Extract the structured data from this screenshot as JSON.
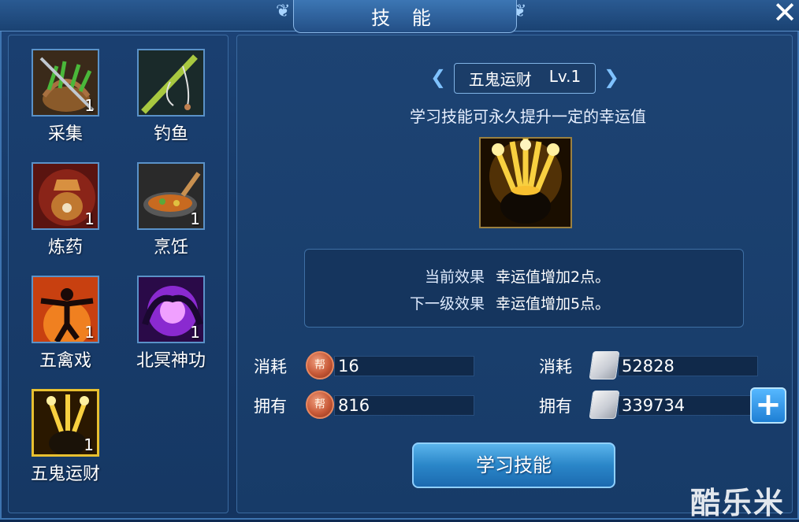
{
  "window": {
    "title": "技 能",
    "close_symbol": "✕"
  },
  "skills": [
    {
      "name": "采集",
      "count": "1",
      "icon": "gathering-icon"
    },
    {
      "name": "钓鱼",
      "count": "",
      "icon": "fishing-icon"
    },
    {
      "name": "炼药",
      "count": "1",
      "icon": "alchemy-icon"
    },
    {
      "name": "烹饪",
      "count": "1",
      "icon": "cooking-icon"
    },
    {
      "name": "五禽戏",
      "count": "1",
      "icon": "five-animals-icon"
    },
    {
      "name": "北冥神功",
      "count": "1",
      "icon": "beiming-icon"
    },
    {
      "name": "五鬼运财",
      "count": "1",
      "icon": "treasure-pot-icon",
      "selected": true
    }
  ],
  "detail": {
    "skill_name": "五鬼运财",
    "level": "Lv.1",
    "description": "学习技能可永久提升一定的幸运值",
    "current_label": "当前效果",
    "current_value": "幸运值增加2点。",
    "next_label": "下一级效果",
    "next_value": "幸运值增加5点。"
  },
  "costs": {
    "consume_label": "消耗",
    "own_label": "拥有",
    "coin_glyph": "帮",
    "coin_consume": "16",
    "coin_own": "816",
    "silver_consume": "52828",
    "silver_own": "339734"
  },
  "buttons": {
    "learn": "学习技能",
    "plus": "+"
  },
  "watermark": "酷乐米",
  "colors": {
    "selected_border": "#e8c030",
    "learn_button": "#2a86c8",
    "coin": "#c85a38"
  }
}
